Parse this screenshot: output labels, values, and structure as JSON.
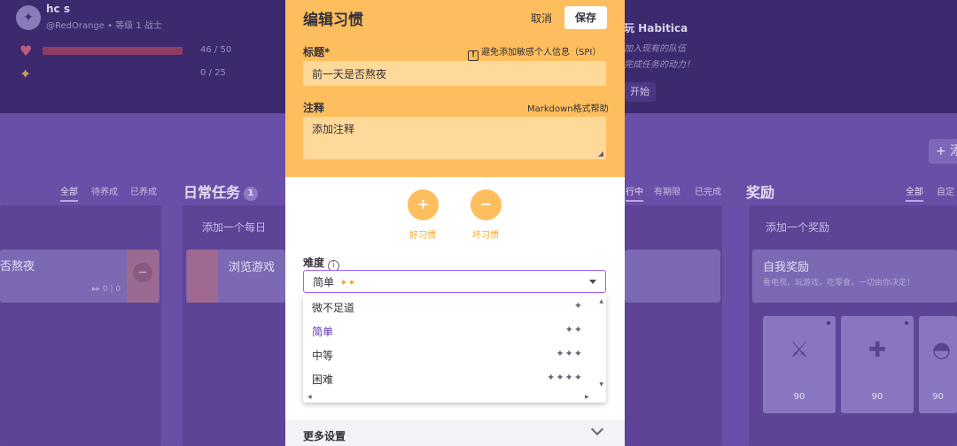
{
  "header": {
    "user_name": "hc s",
    "user_sub": "@RedOrange • 等级 1 战士",
    "hp_value": "46 / 50",
    "xp_value": "0 / 25",
    "promo_title": "玩 Habitica",
    "promo_line1": "加入现有的队伍",
    "promo_line2": "完成任务的动力！",
    "promo_button": "开始"
  },
  "habits_column": {
    "filters": [
      "全部",
      "待养成",
      "已养成"
    ],
    "task_text": "否熬夜",
    "task_counter": "▸▸ 0 | 0"
  },
  "dailies_column": {
    "title": "日常任务",
    "badge": "1",
    "add_placeholder": "添加一个每日",
    "task_text": "浏览游戏",
    "filters": [
      "行中",
      "有期限",
      "已完成"
    ]
  },
  "rewards_column": {
    "title": "奖励",
    "filters": [
      "全部",
      "自定"
    ],
    "add_placeholder": "添加一个奖励",
    "reward_title": "自我奖励",
    "reward_desc": "看电视，玩游戏，吃零食，一切由你决定！",
    "tiles": [
      {
        "icon": "sword-icon",
        "price": "90"
      },
      {
        "icon": "armor-icon",
        "price": "90"
      },
      {
        "icon": "helmet-icon",
        "price": "90"
      }
    ]
  },
  "top_right_add": "+ 添",
  "modal": {
    "title": "编辑习惯",
    "cancel_label": "取消",
    "save_label": "保存",
    "title_label": "标题*",
    "spi_notice": "避免添加敏感个人信息（SPI）",
    "title_value": "前一天是否熬夜",
    "notes_label": "注释",
    "markdown_help": "Markdown格式帮助",
    "notes_placeholder": "添加注释",
    "good_habit_label": "好习惯",
    "bad_habit_label": "坏习惯",
    "difficulty_label": "难度",
    "difficulty_selected": "简单",
    "difficulty_selected_stars": "✦✦",
    "difficulty_options": [
      {
        "label": "微不足道",
        "stars": "✦"
      },
      {
        "label": "简单",
        "stars": "✦✦"
      },
      {
        "label": "中等",
        "stars": "✦✦✦"
      },
      {
        "label": "困难",
        "stars": "✦✦✦✦"
      }
    ],
    "more_settings_label": "更多设置"
  },
  "colors": {
    "modal_header": "#ffbe5d",
    "input_bg": "#ffd99a",
    "select_border": "#9a62ff",
    "selected_option": "#6133b4",
    "background": "#6a4fa8"
  }
}
